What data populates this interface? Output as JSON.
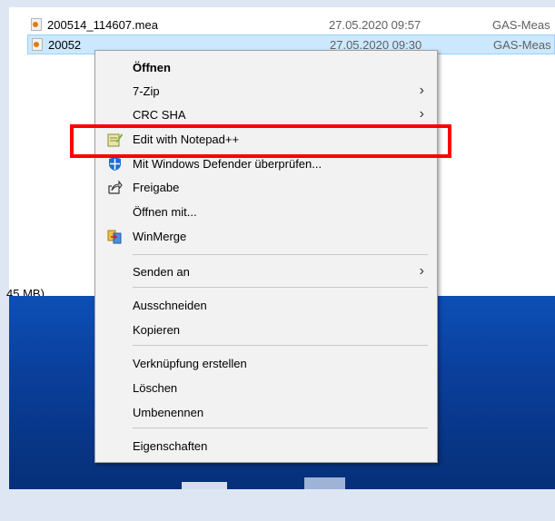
{
  "files": [
    {
      "name": "200514_114607.mea",
      "date": "27.05.2020 09:57",
      "type": "GAS-Meas"
    },
    {
      "name": "20052",
      "date": "27.05.2020 09:30",
      "type": "GAS-Meas"
    }
  ],
  "size_text": "45 MB)",
  "context_menu": {
    "items": [
      {
        "label": "Öffnen",
        "bold": true
      },
      {
        "label": "7-Zip",
        "submenu": true
      },
      {
        "label": "CRC SHA",
        "submenu": true
      },
      {
        "label": "Edit with Notepad++",
        "icon": "notepad-plus-plus-icon"
      },
      {
        "label": "Mit Windows Defender überprüfen...",
        "icon": "windows-defender-icon"
      },
      {
        "label": "Freigabe",
        "icon": "share-icon"
      },
      {
        "label": "Öffnen mit..."
      },
      {
        "label": "WinMerge",
        "icon": "winmerge-icon"
      },
      {
        "label": "Senden an",
        "submenu": true
      },
      {
        "label": "Ausschneiden"
      },
      {
        "label": "Kopieren"
      },
      {
        "label": "Verknüpfung erstellen"
      },
      {
        "label": "Löschen"
      },
      {
        "label": "Umbenennen"
      },
      {
        "label": "Eigenschaften"
      }
    ],
    "submenu_glyph": "›"
  },
  "colors": {
    "highlight_box": "#ff0000",
    "selected_row": "#cce8ff",
    "desktop": "#0d4fb6"
  }
}
